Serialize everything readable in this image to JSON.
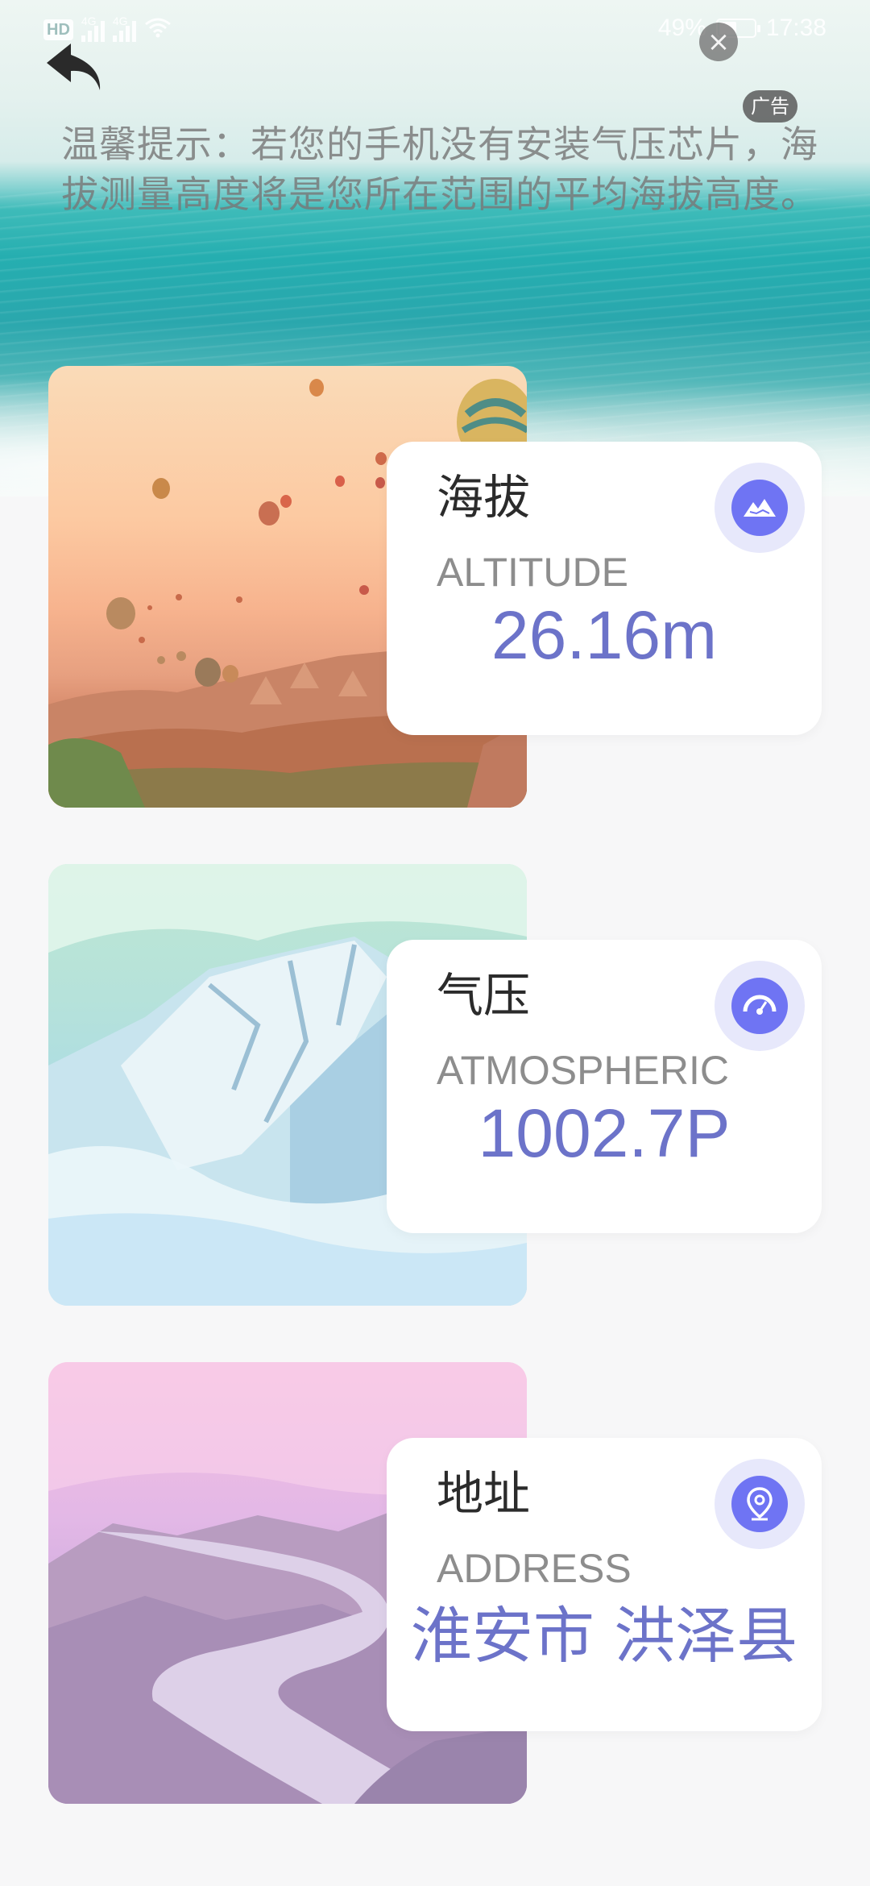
{
  "status_bar": {
    "hd": "HD",
    "network1": "4G",
    "network2": "4G",
    "battery": "49%",
    "time": "17:38"
  },
  "ad": {
    "badge": "广告",
    "close_icon": "close-icon"
  },
  "tip": "温馨提示：若您的手机没有安装气压芯片，海拔测量高度将是您所在范围的平均海拔高度。",
  "cards": {
    "altitude": {
      "title": "海拔",
      "subtitle": "ALTITUDE",
      "value": "26.16m",
      "icon": "mountain-icon"
    },
    "pressure": {
      "title": "气压",
      "subtitle": "ATMOSPHERIC",
      "value": "1002.7P",
      "icon": "gauge-icon"
    },
    "address": {
      "title": "地址",
      "subtitle": "ADDRESS",
      "value": "淮安市 洪泽县",
      "icon": "location-pin-icon"
    }
  },
  "colors": {
    "accent": "#6c73c9",
    "icon_bg": "#6f74f3",
    "icon_ring": "#e7e8fb"
  }
}
